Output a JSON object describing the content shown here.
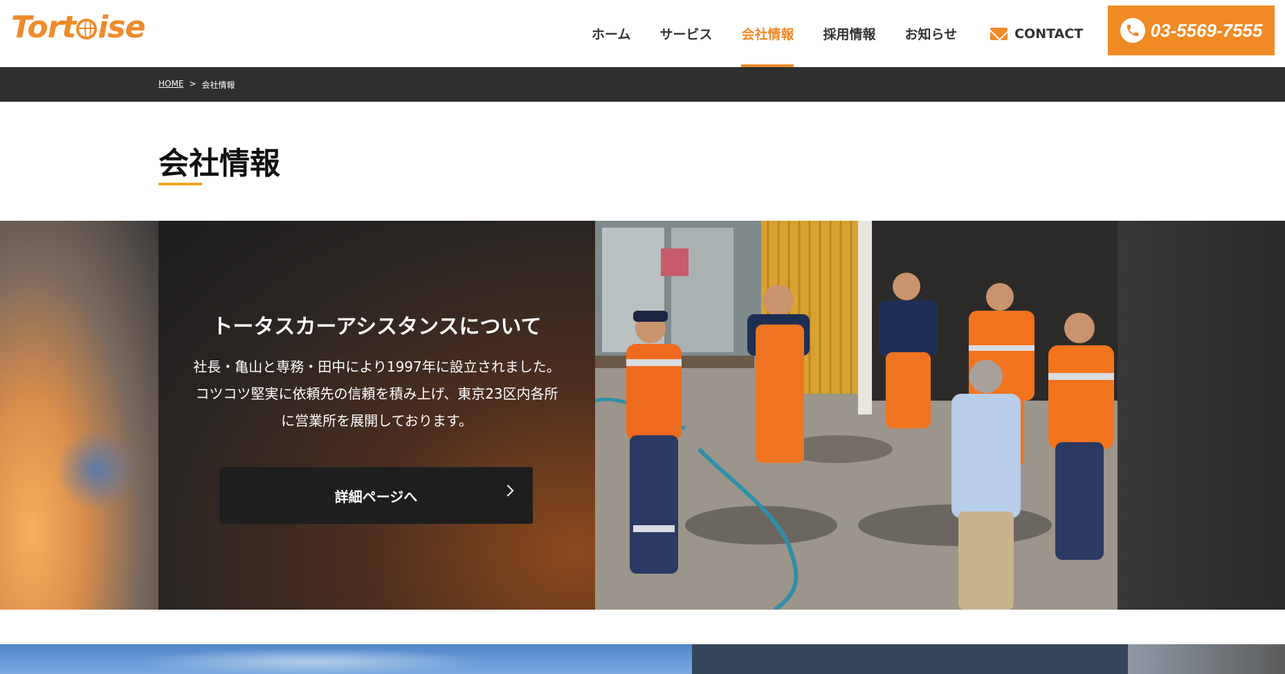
{
  "brand": {
    "logo_text_before": "Tort",
    "logo_text_after": "ise",
    "accent_color": "#ef8a2a"
  },
  "nav": {
    "items": [
      {
        "label": "ホーム",
        "active": false
      },
      {
        "label": "サービス",
        "active": false
      },
      {
        "label": "会社情報",
        "active": true
      },
      {
        "label": "採用情報",
        "active": false
      },
      {
        "label": "お知らせ",
        "active": false
      }
    ],
    "contact_label": "CONTACT",
    "contact_icon": "mail-icon",
    "phone_number": "03-5569-7555",
    "phone_icon": "phone-icon"
  },
  "breadcrumb": {
    "home": "HOME",
    "separator": ">",
    "current": "会社情報"
  },
  "page": {
    "title": "会社情報"
  },
  "hero": {
    "heading": "トータスカーアシスタンスについて",
    "body_lines": [
      "社長・亀山と専務・田中により1997年に設立されました。",
      "コツコツ堅実に依頼先の信頼を積み上げ、東京23区内各所",
      "に営業所を展開しております。"
    ],
    "button_label": "詳細ページへ"
  }
}
